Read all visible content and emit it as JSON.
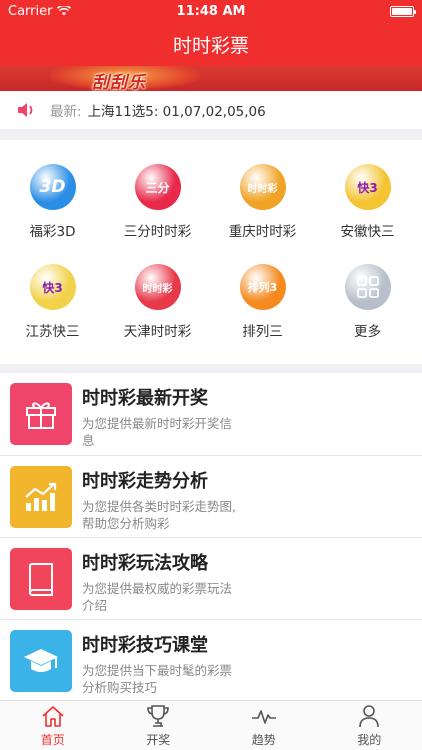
{
  "status_bar": {
    "carrier": "Carrier",
    "time": "11:48 AM"
  },
  "nav": {
    "title": "时时彩票"
  },
  "banner": {
    "text": "刮刮乐"
  },
  "notice": {
    "prefix": "最新:",
    "text": "上海11选5: 01,07,02,05,06"
  },
  "lotteries": [
    {
      "label": "福彩3D",
      "icon": "3d-icon",
      "badge": "3D",
      "color": "#2b8ee6"
    },
    {
      "label": "三分时时彩",
      "icon": "sanfen-icon",
      "badge": "三分",
      "color": "#e8294a"
    },
    {
      "label": "重庆时时彩",
      "icon": "chongqing-icon",
      "badge": "时时彩",
      "color": "#f0a326"
    },
    {
      "label": "安徽快三",
      "icon": "anhui-k3-icon",
      "badge": "快3",
      "color": "#f4c434"
    },
    {
      "label": "江苏快三",
      "icon": "jiangsu-k3-icon",
      "badge": "快3",
      "color": "#f2d24a"
    },
    {
      "label": "天津时时彩",
      "icon": "tianjin-icon",
      "badge": "时时彩",
      "color": "#e8394a"
    },
    {
      "label": "排列三",
      "icon": "pailie3-icon",
      "badge": "排列3",
      "color": "#f58a1f"
    },
    {
      "label": "更多",
      "icon": "more-grid-icon",
      "badge": "",
      "color": "#b7c0ca"
    }
  ],
  "features": [
    {
      "title": "时时彩最新开奖",
      "desc": "为您提供最新时时彩开奖信息",
      "icon": "gift-icon",
      "color": "#f0456a"
    },
    {
      "title": "时时彩走势分析",
      "desc": "为您提供各类时时彩走势图,帮助您分析购彩",
      "icon": "trend-chart-icon",
      "color": "#f1b62b"
    },
    {
      "title": "时时彩玩法攻略",
      "desc": "为您提供最权威的彩票玩法介绍",
      "icon": "book-icon",
      "color": "#f0455a"
    },
    {
      "title": "时时彩技巧课堂",
      "desc": "为您提供当下最时髦的彩票分析购买技巧",
      "icon": "graduation-cap-icon",
      "color": "#3cb3e8"
    }
  ],
  "tabs": [
    {
      "label": "首页",
      "icon": "home-icon",
      "active": true
    },
    {
      "label": "开奖",
      "icon": "trophy-icon",
      "active": false
    },
    {
      "label": "趋势",
      "icon": "pulse-icon",
      "active": false
    },
    {
      "label": "我的",
      "icon": "user-icon",
      "active": false
    }
  ]
}
